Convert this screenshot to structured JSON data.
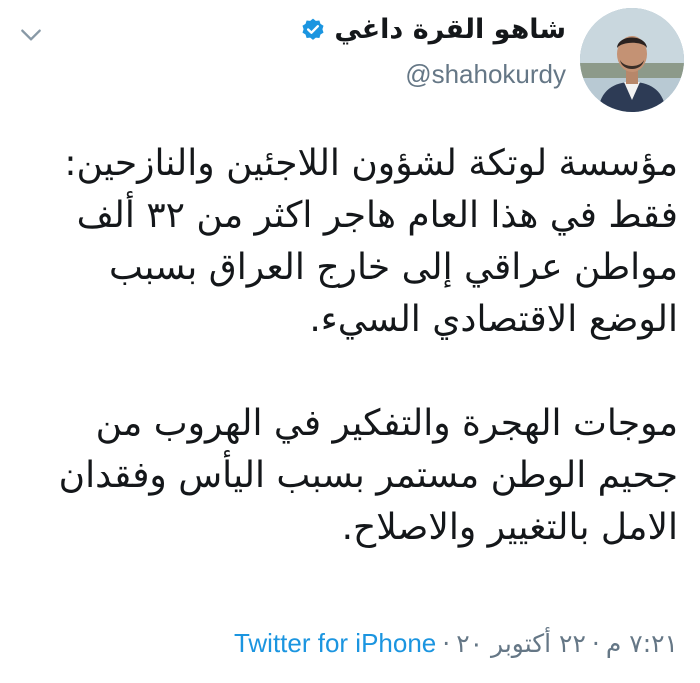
{
  "author": {
    "display_name": "شاهو القرة داغي",
    "handle": "@shahokurdy",
    "verified": true
  },
  "icons": {
    "verified": "verified-badge-icon",
    "menu": "chevron-down-icon"
  },
  "tweet": {
    "paragraphs": [
      "مؤسسة لوتكة لشؤون اللاجئين والنازحين:\nفقط في هذا العام هاجر اكثر من ٣٢ ألف\nمواطن عراقي إلى خارج العراق بسبب\nالوضع الاقتصادي السيء.",
      "موجات الهجرة والتفكير في الهروب من\nجحيم الوطن مستمر بسبب اليأس وفقدان\nالامل بالتغيير والاصلاح."
    ]
  },
  "meta": {
    "time": "٧:٢١ م",
    "date": "٢٢ أكتوبر ٢٠",
    "separator": "·",
    "source": "Twitter for iPhone"
  },
  "colors": {
    "accent": "#1b95e0",
    "secondary_text": "#657786",
    "primary_text": "#14171a",
    "chevron": "#8899a6"
  }
}
